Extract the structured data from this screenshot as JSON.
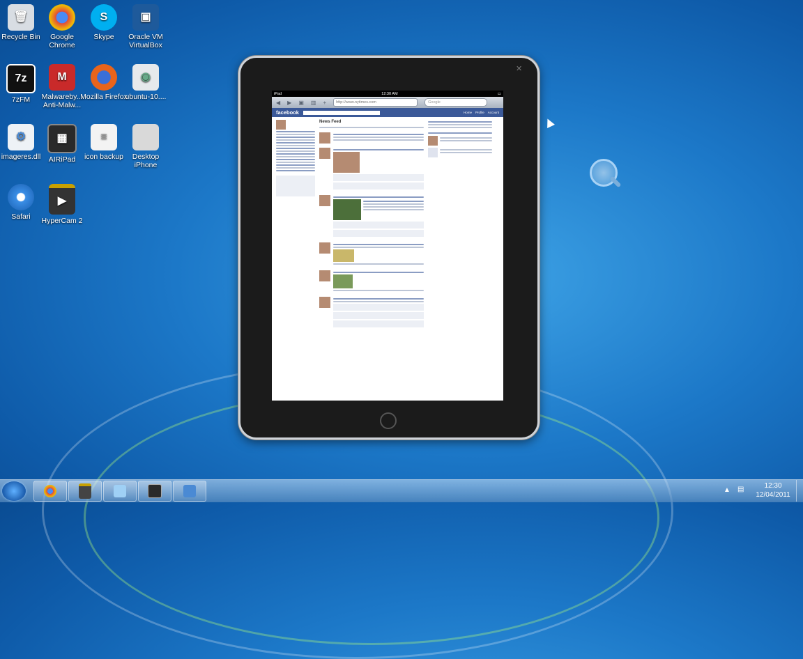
{
  "desktop": {
    "icons": [
      {
        "label": "Recycle Bin",
        "icon": "recycle-bin-icon",
        "color": "#d8dde3"
      },
      {
        "label": "Google Chrome",
        "icon": "chrome-icon",
        "color": "#e04a3b"
      },
      {
        "label": "Skype",
        "icon": "skype-icon",
        "color": "#00aff0"
      },
      {
        "label": "Oracle VM VirtualBox",
        "icon": "virtualbox-icon",
        "color": "#1e5a9b"
      },
      {
        "label": "7zFM",
        "icon": "7zip-icon",
        "color": "#111111"
      },
      {
        "label": "Malwareby... Anti-Malw...",
        "icon": "malwarebytes-icon",
        "color": "#c92a2a"
      },
      {
        "label": "Mozilla Firefox",
        "icon": "firefox-icon",
        "color": "#e8641b"
      },
      {
        "label": "ubuntu-10....",
        "icon": "disc-image-icon",
        "color": "#e6e9ec"
      },
      {
        "label": "imageres.dll",
        "icon": "dll-file-icon",
        "color": "#eef2f6"
      },
      {
        "label": "AIRiPad",
        "icon": "airipad-icon",
        "color": "#2a2a2a"
      },
      {
        "label": "icon backup",
        "icon": "text-file-icon",
        "color": "#f3f3f3"
      },
      {
        "label": "Desktop iPhone",
        "icon": "apple-icon",
        "color": "#d9d9d9"
      },
      {
        "label": "Safari",
        "icon": "safari-icon",
        "color": "#3a8ee6"
      },
      {
        "label": "HyperCam 2",
        "icon": "hypercam-icon",
        "color": "#333333"
      }
    ]
  },
  "ipad": {
    "status_carrier": "iPad",
    "status_time": "12:30 AM",
    "url": "http://www.nytimes.com",
    "search_placeholder": "Google",
    "fb_logo": "facebook",
    "fb_nav": [
      "Home",
      "Profile",
      "Account"
    ],
    "feed_title": "News Feed"
  },
  "taskbar": {
    "apps": [
      {
        "name": "chrome",
        "icon": "chrome-icon",
        "color": "#e04a3b"
      },
      {
        "name": "hypercam",
        "icon": "hypercam-icon",
        "color": "#444444"
      },
      {
        "name": "notepad",
        "icon": "notepad-icon",
        "color": "#9fd0f5"
      },
      {
        "name": "airipad",
        "icon": "airipad-icon",
        "color": "#2a2a2a"
      },
      {
        "name": "imageres",
        "icon": "dll-file-icon",
        "color": "#4a8ad4"
      }
    ],
    "clock_time": "12:30",
    "clock_date": "12/04/2011"
  }
}
